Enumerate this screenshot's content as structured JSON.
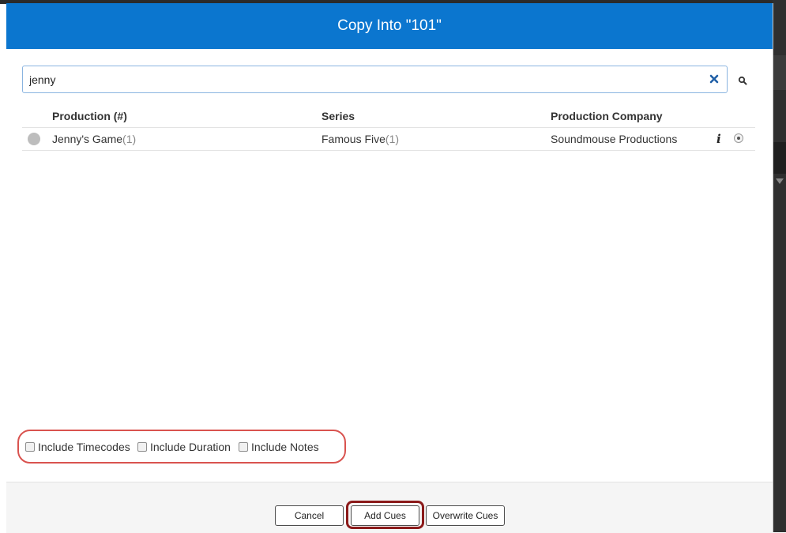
{
  "dialog": {
    "title": "Copy Into \"101\""
  },
  "search": {
    "value": "jenny",
    "clear_icon": "close-icon",
    "search_icon": "search-icon"
  },
  "table": {
    "columns": [
      "Production (#)",
      "Series",
      "Production Company"
    ],
    "rows": [
      {
        "production": "Jenny's Game",
        "production_count": "(1)",
        "series": "Famous Five",
        "series_count": "(1)",
        "company": "Soundmouse Productions",
        "info_icon": "info-icon",
        "status_color": "#bdbdbd"
      }
    ]
  },
  "options": {
    "include_timecodes": "Include Timecodes",
    "include_duration": "Include Duration",
    "include_notes": "Include Notes"
  },
  "buttons": {
    "cancel": "Cancel",
    "add_cues": "Add Cues",
    "overwrite_cues": "Overwrite Cues"
  },
  "colors": {
    "header_bg": "#0b76cf",
    "highlight_red": "#d9534f",
    "highlight_dark_red": "#8b1a1a"
  }
}
